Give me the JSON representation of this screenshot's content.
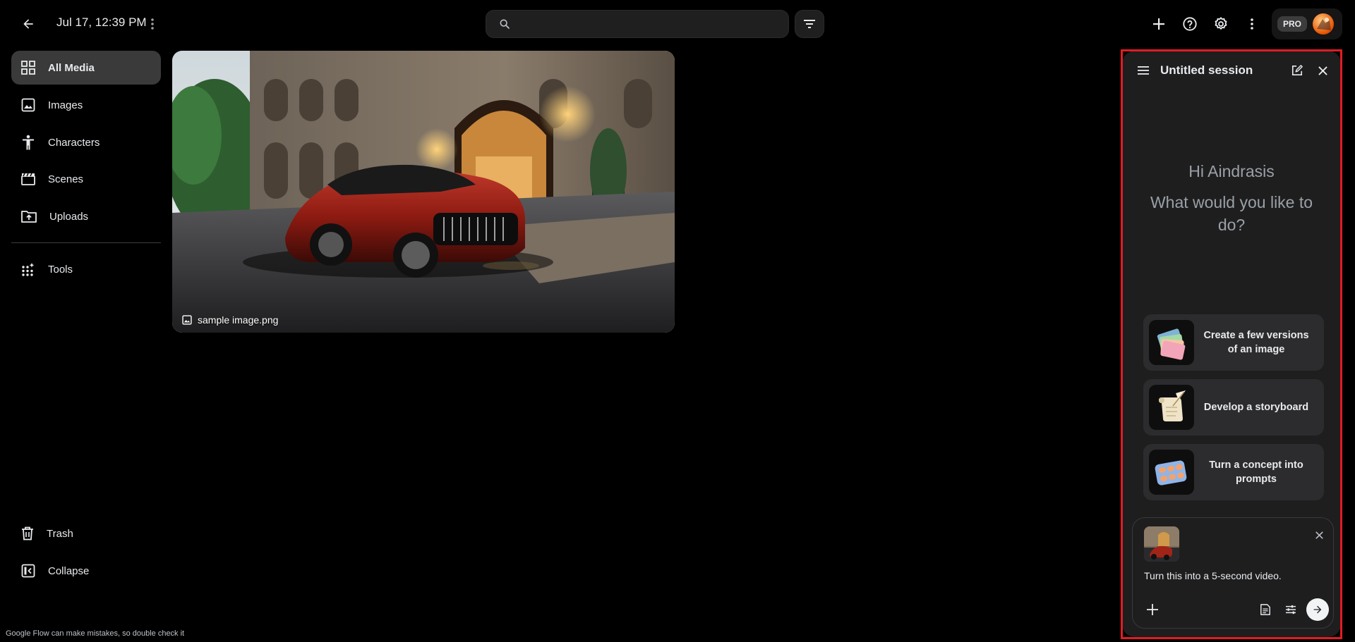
{
  "header": {
    "title": "Jul 17, 12:39 PM",
    "search_placeholder": "",
    "pro_badge": "PRO"
  },
  "sidebar": {
    "items": [
      {
        "label": "All Media",
        "icon": "grid-icon",
        "active": true
      },
      {
        "label": "Images",
        "icon": "image-icon"
      },
      {
        "label": "Characters",
        "icon": "person-icon"
      },
      {
        "label": "Scenes",
        "icon": "clapperboard-icon"
      },
      {
        "label": "Uploads",
        "icon": "upload-folder-icon"
      },
      {
        "label": "Tools",
        "icon": "tools-grid-icon"
      }
    ],
    "bottom": [
      {
        "label": "Trash",
        "icon": "trash-icon"
      },
      {
        "label": "Collapse",
        "icon": "collapse-icon"
      }
    ],
    "disclaimer": "Google Flow can make mistakes, so double check it"
  },
  "media": {
    "caption": "sample image.png"
  },
  "assistant": {
    "title": "Untitled session",
    "greeting": "Hi Aindrasis",
    "question": "What would you like to do?",
    "suggestions": [
      {
        "label": "Create a few versions of an image",
        "icon": "stacked-cards-icon"
      },
      {
        "label": "Develop a storyboard",
        "icon": "scroll-quill-icon"
      },
      {
        "label": "Turn a concept into prompts",
        "icon": "pill-pack-icon"
      }
    ],
    "composer_text": "Turn this into a 5-second video."
  },
  "colors": {
    "background": "#000000",
    "panel": "#1e1e1f",
    "highlight_outline": "#e21b23"
  }
}
